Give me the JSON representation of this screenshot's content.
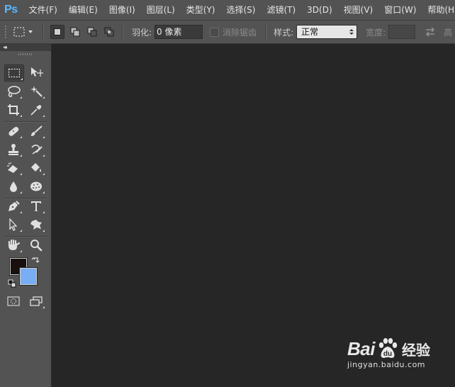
{
  "app": {
    "logo": "Ps"
  },
  "menu": [
    "文件(F)",
    "编辑(E)",
    "图像(I)",
    "图层(L)",
    "类型(Y)",
    "选择(S)",
    "滤镜(T)",
    "3D(D)",
    "视图(V)",
    "窗口(W)",
    "帮助(H)"
  ],
  "options": {
    "feather_label": "羽化:",
    "feather_value": "0 像素",
    "antialias_label": "消除锯齿",
    "style_label": "样式:",
    "style_value": "正常",
    "width_label": "宽度:",
    "height_label": "高"
  },
  "toolbox": {
    "collapse": "◂◂",
    "foreground_color": "#180f0f",
    "background_color": "#78aef5"
  },
  "workspace": {
    "background": "#262626"
  },
  "watermark": {
    "brand": "Bai",
    "brand_suffix": "经验",
    "url": "jingyan.baidu.com"
  }
}
